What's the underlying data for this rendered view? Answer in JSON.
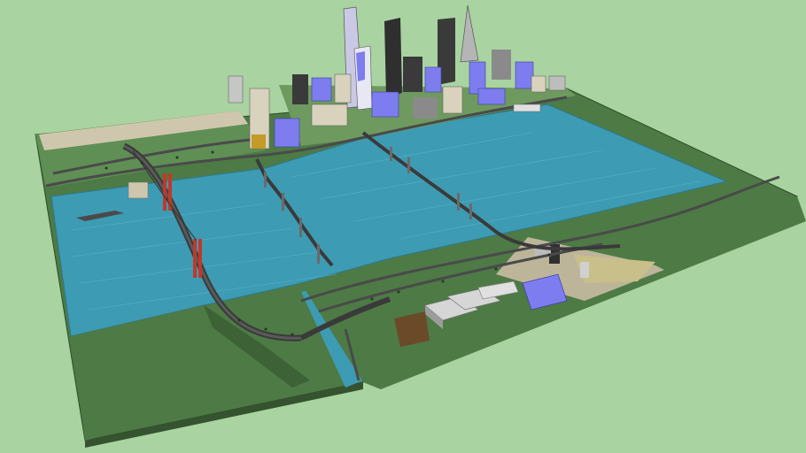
{
  "scene": {
    "colors": {
      "background": "#a9d3a0",
      "water": "#3d9bb3",
      "ground": "#4d7a45",
      "ground_light": "#5f8f55",
      "road": "#4a4a4a",
      "bridge_tower": "#c0392b",
      "building_blue": "#7d7df0",
      "building_gray": "#8a8a8a",
      "building_beige": "#d9d2bc",
      "building_dark": "#2f2f2f"
    }
  }
}
